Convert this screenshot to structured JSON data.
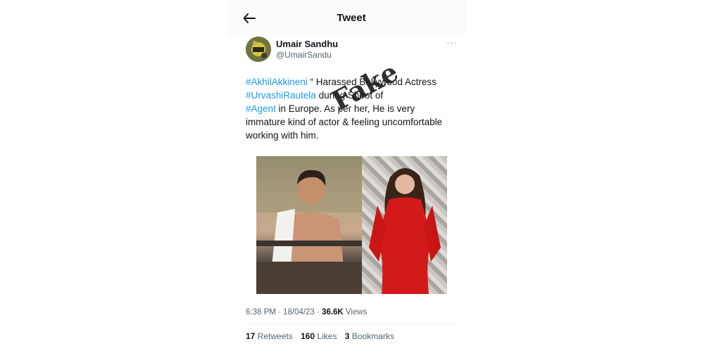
{
  "header": {
    "title": "Tweet",
    "back_icon": "arrow-left-icon"
  },
  "author": {
    "name": "Umair Sandhu",
    "handle": "@UmairSandu",
    "more_icon": "more-horizontal-icon"
  },
  "tweet": {
    "line1_tag": "#AkhilAkkineni",
    "line1_text": " “ Harassed Bollywood Actress",
    "line2_tag": "#UrvashiRautela",
    "line2_text": " during Shoot of",
    "line3_tag": "#Agent",
    "line3_text": " in Europe. As per her, He is very",
    "line4_text": "immature kind of actor & feeling uncomfortable",
    "line5_text": "working with him."
  },
  "stamp": {
    "text": "Fake"
  },
  "meta": {
    "time": "6:38 PM · 18/04/23 · ",
    "views_count": "36.6K",
    "views_label": " Views"
  },
  "stats": {
    "retweets_count": "17",
    "retweets_label": " Retweets",
    "likes_count": "160",
    "likes_label": " Likes",
    "bookmarks_count": "3",
    "bookmarks_label": " Bookmarks"
  },
  "colors": {
    "link": "#1d9bf0",
    "text": "#0f1419",
    "muted": "#536471"
  }
}
